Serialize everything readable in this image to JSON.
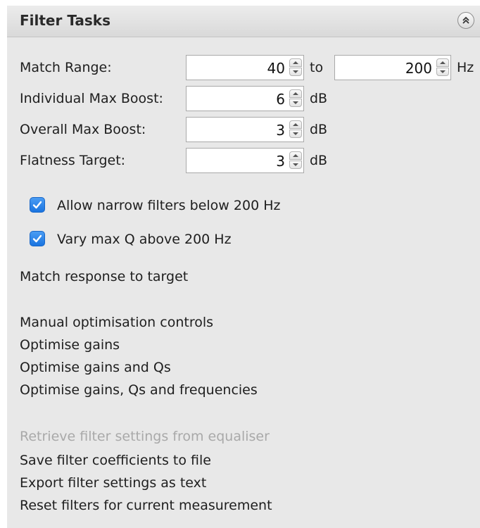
{
  "panel": {
    "title": "Filter Tasks",
    "collapse_icon": "double-chevron-up-icon"
  },
  "fields": {
    "match_range": {
      "label": "Match Range:",
      "from": "40",
      "to_label": "to",
      "to": "200",
      "unit": "Hz"
    },
    "individual_max_boost": {
      "label": "Individual Max Boost:",
      "value": "6",
      "unit": "dB"
    },
    "overall_max_boost": {
      "label": "Overall Max Boost:",
      "value": "3",
      "unit": "dB"
    },
    "flatness_target": {
      "label": "Flatness Target:",
      "value": "3",
      "unit": "dB"
    }
  },
  "checkboxes": {
    "allow_narrow": {
      "label": "Allow narrow filters below 200 Hz",
      "checked": true
    },
    "vary_max_q": {
      "label": "Vary max Q above 200 Hz",
      "checked": true
    }
  },
  "actions": {
    "match_response": "Match response to target",
    "manual_controls": "Manual optimisation controls",
    "optimise_gains": "Optimise gains",
    "optimise_gains_qs": "Optimise gains and Qs",
    "optimise_all": "Optimise gains, Qs and frequencies",
    "retrieve_settings": "Retrieve filter settings from equaliser",
    "save_coefficients": "Save filter coefficients to file",
    "export_settings": "Export filter settings as text",
    "reset_filters": "Reset filters for current measurement"
  },
  "colors": {
    "panel_bg": "#e8e8e8",
    "checkbox_accent": "#2a86ea",
    "disabled_text": "#a9a9a9"
  }
}
